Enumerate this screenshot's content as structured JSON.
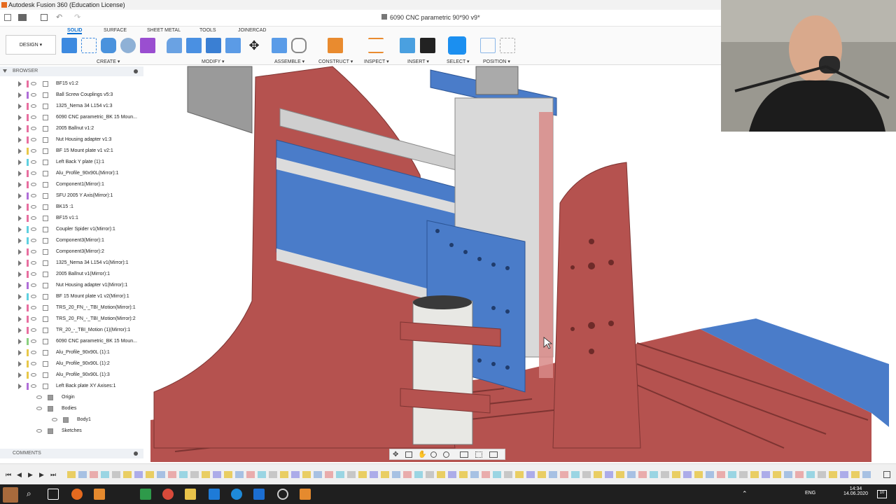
{
  "app": {
    "window_title": "Autodesk Fusion 360 (Education License)",
    "document_title": "6090 CNC parametric 90*90 v9*"
  },
  "workspace": {
    "label": "DESIGN ▾"
  },
  "ribbon": {
    "tabs": [
      "SOLID",
      "SURFACE",
      "SHEET METAL",
      "TOOLS",
      "JOINERCAD"
    ],
    "groups": [
      "CREATE ▾",
      "MODIFY ▾",
      "ASSEMBLE ▾",
      "CONSTRUCT ▾",
      "INSPECT ▾",
      "INSERT ▾",
      "SELECT ▾",
      "POSITION ▾"
    ]
  },
  "browser": {
    "header": "BROWSER",
    "items": [
      {
        "label": "BF15 v1:2",
        "color": "#e86fa0"
      },
      {
        "label": "Ball Screw Couplings v5:3",
        "color": "#b06fd8"
      },
      {
        "label": "1325_Nema 34 L154 v1:3",
        "color": "#e86fa0"
      },
      {
        "label": "6090 CNC parametric_BK 15 Moun...",
        "color": "#e86fa0"
      },
      {
        "label": "2005 Ballnut v1:2",
        "color": "#e86fa0"
      },
      {
        "label": "Nut Housing adapter v1:3",
        "color": "#e86fa0"
      },
      {
        "label": "BF 15 Mount plate v1 v2:1",
        "color": "#e8c84a"
      },
      {
        "label": "Left Back Y plate (1):1",
        "color": "#5fd0e0"
      },
      {
        "label": "Alu_Profile_90x90L(Mirror):1",
        "color": "#e86fa0"
      },
      {
        "label": "Component1(Mirror):1",
        "color": "#e86fa0"
      },
      {
        "label": "SFU 2005 Y Axis(Mirror):1",
        "color": "#b06fd8"
      },
      {
        "label": "BK15 :1",
        "color": "#e86fa0"
      },
      {
        "label": "BF15 v1:1",
        "color": "#e86fa0"
      },
      {
        "label": "Coupler Spider v1(Mirror):1",
        "color": "#5fd0e0"
      },
      {
        "label": "Component3(Mirror):1",
        "color": "#5fd0e0"
      },
      {
        "label": "Component3(Mirror):2",
        "color": "#e86fa0"
      },
      {
        "label": "1325_Nema 34 L154 v1(Mirror):1",
        "color": "#e86fa0"
      },
      {
        "label": "2005 Ballnut v1(Mirror):1",
        "color": "#e86fa0"
      },
      {
        "label": "Nut Housing adapter v1(Mirror):1",
        "color": "#b06fd8"
      },
      {
        "label": "BF 15 Mount plate v1 v2(Mirror):1",
        "color": "#5fd0e0"
      },
      {
        "label": "TRS_20_FN_-_TBI_Motion(Mirror):1",
        "color": "#e86fa0"
      },
      {
        "label": "TRS_20_FN_-_TBI_Motion(Mirror):2",
        "color": "#e86fa0"
      },
      {
        "label": "TR_20_-_TBI_Motion (1)(Mirror):1",
        "color": "#e86fa0"
      },
      {
        "label": "6090 CNC parametric_BK 15 Moun...",
        "color": "#8bd080"
      },
      {
        "label": "Alu_Profile_90x90L (1):1",
        "color": "#e8c84a"
      },
      {
        "label": "Alu_Profile_90x90L (1):2",
        "color": "#e8c84a"
      },
      {
        "label": "Alu_Profile_90x90L (1):3",
        "color": "#e8c84a"
      },
      {
        "label": "Left Back plate XY Axises:1",
        "color": "#b06fd8"
      }
    ],
    "sub_items": [
      "Origin",
      "Bodies",
      "Body1",
      "Sketches"
    ]
  },
  "comments": {
    "label": "COMMENTS"
  },
  "taskbar": {
    "time": "14:34",
    "date": "14.06.2020",
    "language": "ENG",
    "notification_count": "10"
  },
  "colors": {
    "frame_red": "#b5524f",
    "carriage_blue": "#4a7cc9",
    "rail_gray": "#c8c8c8",
    "accent_blue": "#0a6fd1"
  }
}
